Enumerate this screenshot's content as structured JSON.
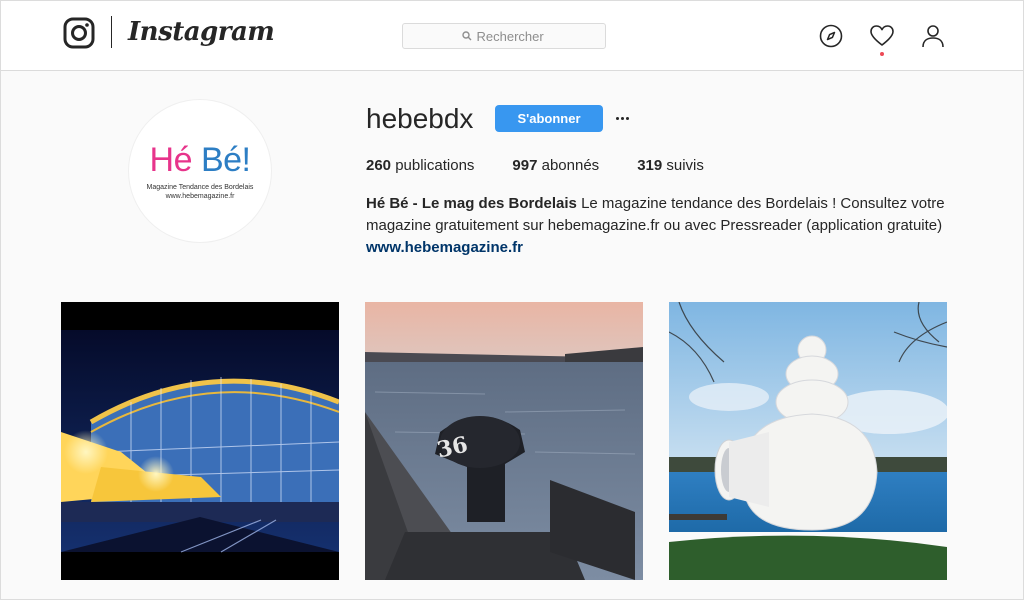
{
  "app": {
    "wordmark": "Instagram"
  },
  "search": {
    "placeholder": "Rechercher"
  },
  "nav": {
    "icons": [
      "compass-icon",
      "heart-icon",
      "person-icon"
    ],
    "has_notification": true
  },
  "profile": {
    "username": "hebebdx",
    "follow_label": "S'abonner",
    "avatar": {
      "title_part1": "Hé ",
      "title_part2": "Bé!",
      "subtitle": "Magazine Tendance des Bordelais",
      "url": "www.hebemagazine.fr"
    },
    "stats": {
      "posts_count": "260",
      "posts_label": " publications",
      "followers_count": "997",
      "followers_label": " abonnés",
      "following_count": "319",
      "following_label": " suivis"
    },
    "bio": {
      "name": "Hé Bé - Le mag des Bordelais",
      "text": " Le magazine tendance des Bordelais ! Consultez votre magazine gratuitement sur hebemagazine.fr ou avec Pressreader (application gratuite)",
      "link": "www.hebemagazine.fr"
    }
  },
  "posts": [
    {
      "subject": "illuminated train station at night"
    },
    {
      "subject": "mooring bollard numbered 36 on river quay",
      "bollard_number": "36"
    },
    {
      "subject": "giant white seashell sculpture by a lake"
    }
  ],
  "colors": {
    "accent": "#3897f0",
    "link": "#003569",
    "notification": "#ed4956",
    "brand_pink": "#e7348b",
    "brand_blue": "#2d7ec4"
  }
}
